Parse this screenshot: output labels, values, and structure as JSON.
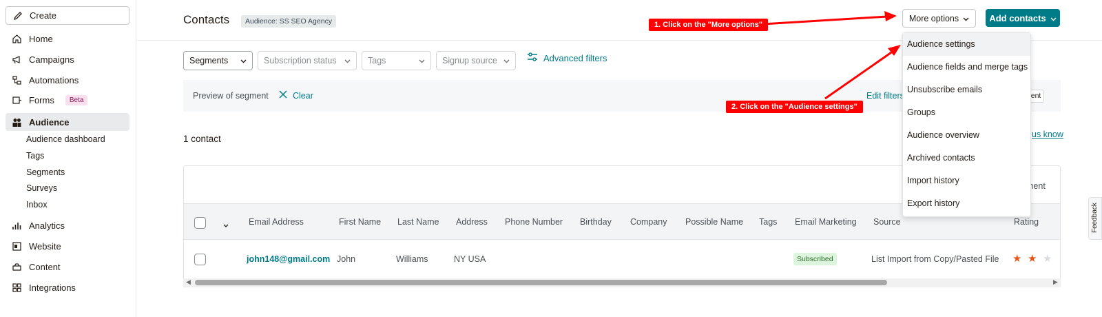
{
  "sidebar": {
    "create_label": "Create",
    "items": [
      {
        "label": "Home",
        "icon": "home-icon"
      },
      {
        "label": "Campaigns",
        "icon": "megaphone-icon"
      },
      {
        "label": "Automations",
        "icon": "flow-icon"
      },
      {
        "label": "Forms",
        "icon": "form-icon",
        "badge": "Beta"
      },
      {
        "label": "Audience",
        "icon": "audience-icon",
        "active": true
      },
      {
        "label": "Analytics",
        "icon": "bar-chart-icon"
      },
      {
        "label": "Website",
        "icon": "website-icon"
      },
      {
        "label": "Content",
        "icon": "content-icon"
      },
      {
        "label": "Integrations",
        "icon": "grid-icon"
      }
    ],
    "subitems": [
      "Audience dashboard",
      "Tags",
      "Segments",
      "Surveys",
      "Inbox"
    ]
  },
  "header": {
    "title": "Contacts",
    "audience_badge": "Audience: SS SEO Agency",
    "more_options": "More options",
    "add_contacts": "Add contacts"
  },
  "filters": {
    "segments": "Segments",
    "subscription_status": "Subscription status",
    "tags": "Tags",
    "signup_source": "Signup source",
    "advanced": "Advanced filters"
  },
  "preview": {
    "label": "Preview of segment",
    "clear": "Clear",
    "edit_filters": "Edit filters",
    "segment_btn": "ment"
  },
  "contact_count": "1 contact",
  "help_link": "us know",
  "table": {
    "right_label": "ment",
    "columns": [
      "Email Address",
      "First Name",
      "Last Name",
      "Address",
      "Phone Number",
      "Birthday",
      "Company",
      "Possible Name",
      "Tags",
      "Email Marketing",
      "Source",
      "Rating"
    ],
    "rows": [
      {
        "email": "john148@gmail.com",
        "first_name": "John",
        "last_name": "Williams",
        "address": "NY USA",
        "email_marketing": "Subscribed",
        "source": "List Import from Copy/Pasted File",
        "rating": 2,
        "rating_max": 3
      }
    ]
  },
  "dropdown": {
    "items": [
      "Audience settings",
      "Audience fields and merge tags",
      "Unsubscribe emails",
      "Groups",
      "Audience overview",
      "Archived contacts",
      "Import history",
      "Export history"
    ]
  },
  "annotations": {
    "step1": "1. Click on the \"More options\"",
    "step2": "2. Click on the \"Audience settings\""
  },
  "feedback": "Feedback",
  "colors": {
    "accent": "#007c89",
    "annotation": "#ff0000",
    "star": "#e4571c"
  }
}
